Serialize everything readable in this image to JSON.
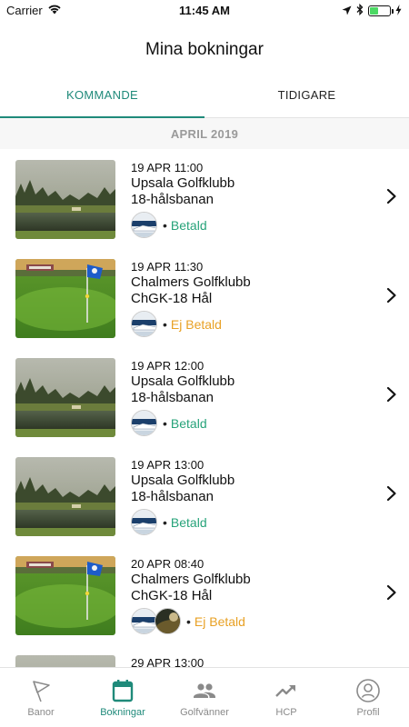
{
  "status_bar": {
    "carrier": "Carrier",
    "time": "11:45 AM"
  },
  "header": {
    "title": "Mina bokningar"
  },
  "tabs": [
    {
      "label": "KOMMANDE",
      "active": true
    },
    {
      "label": "TIDIGARE",
      "active": false
    }
  ],
  "section": {
    "label": "APRIL 2019"
  },
  "bookings": [
    {
      "datetime": "19 APR 11:00",
      "club": "Upsala Golfklubb",
      "course": "18-hålsbanan",
      "status": "Betald",
      "status_type": "paid",
      "image": "lake-course",
      "avatars": 1
    },
    {
      "datetime": "19 APR 11:30",
      "club": "Chalmers Golfklubb",
      "course": "ChGK-18 Hål",
      "status": "Ej Betald",
      "status_type": "unpaid",
      "image": "green-flag",
      "avatars": 1
    },
    {
      "datetime": "19 APR 12:00",
      "club": "Upsala Golfklubb",
      "course": "18-hålsbanan",
      "status": "Betald",
      "status_type": "paid",
      "image": "lake-course",
      "avatars": 1
    },
    {
      "datetime": "19 APR 13:00",
      "club": "Upsala Golfklubb",
      "course": "18-hålsbanan",
      "status": "Betald",
      "status_type": "paid",
      "image": "lake-course",
      "avatars": 1
    },
    {
      "datetime": "20 APR 08:40",
      "club": "Chalmers Golfklubb",
      "course": "ChGK-18 Hål",
      "status": "Ej Betald",
      "status_type": "unpaid",
      "image": "green-flag",
      "avatars": 2
    },
    {
      "datetime": "29 APR 13:00",
      "club": "",
      "course": "",
      "status": "",
      "status_type": "paid",
      "image": "lake-course",
      "avatars": 0
    }
  ],
  "colors": {
    "accent": "#1f8a7a",
    "paid": "#27a37a",
    "unpaid": "#e8a125"
  },
  "bottom_nav": [
    {
      "label": "Banor",
      "icon": "flag-icon",
      "active": false
    },
    {
      "label": "Bokningar",
      "icon": "calendar-icon",
      "active": true
    },
    {
      "label": "Golfvänner",
      "icon": "people-icon",
      "active": false
    },
    {
      "label": "HCP",
      "icon": "trending-up-icon",
      "active": false
    },
    {
      "label": "Profil",
      "icon": "profile-icon",
      "active": false
    }
  ]
}
